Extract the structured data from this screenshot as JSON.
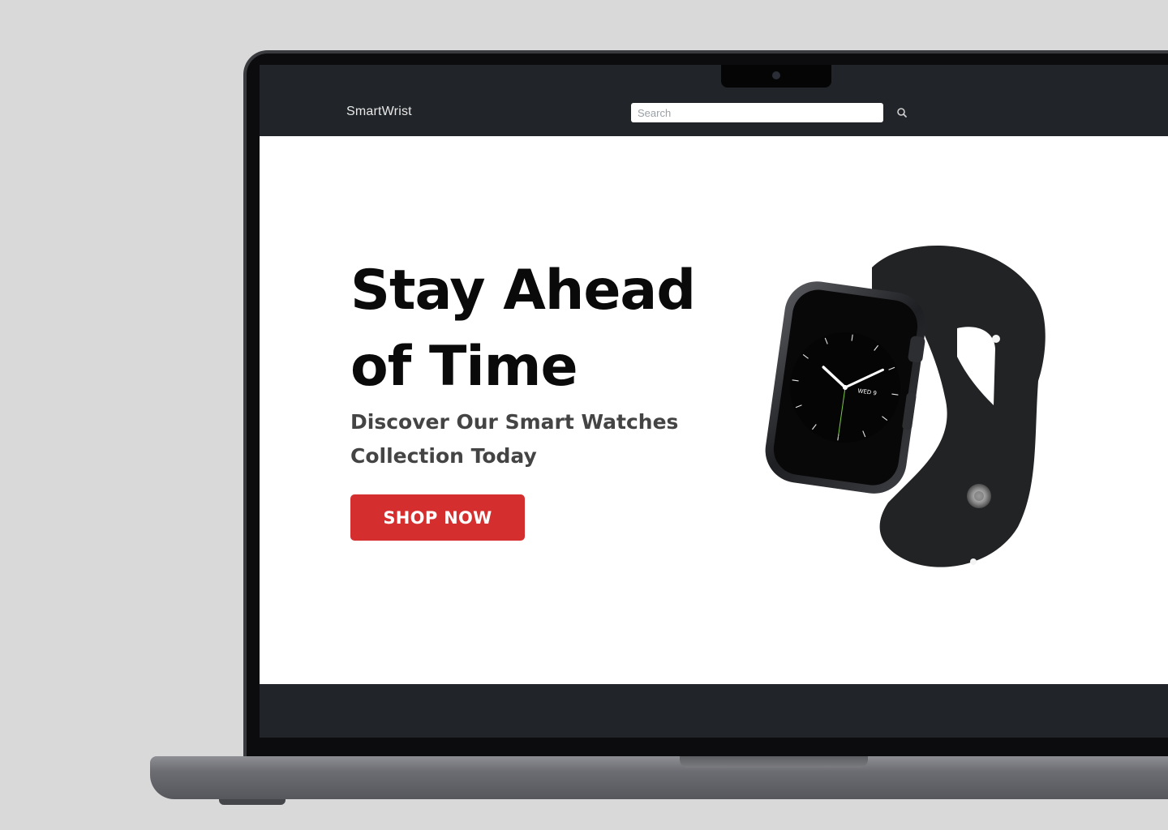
{
  "nav": {
    "brand": "SmartWrist",
    "search_placeholder": "Search",
    "search_icon": "search-icon"
  },
  "hero": {
    "title": "Stay Ahead of Time",
    "subtitle": "Discover Our Smart Watches Collection Today",
    "cta_label": "SHOP NOW"
  },
  "watch": {
    "date": "WED 9"
  },
  "colors": {
    "page_bg": "#d9d9d9",
    "nav_bg": "#212428",
    "cta": "#d42e2e",
    "title": "#0a0a0a",
    "subtitle": "#444444"
  }
}
